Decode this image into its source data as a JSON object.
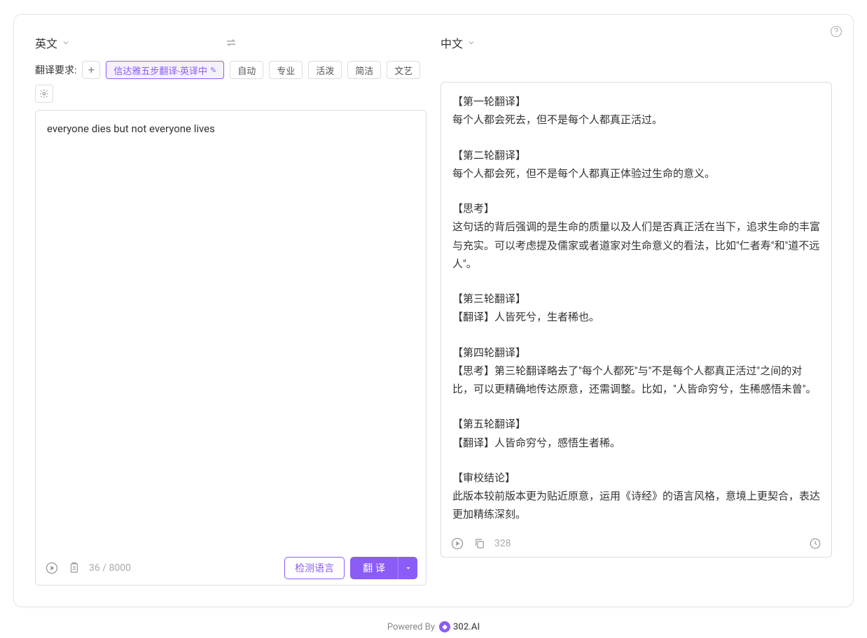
{
  "source_lang": "英文",
  "target_lang": "中文",
  "req_label": "翻译要求:",
  "chips": {
    "active": "信达雅五步翻译-英译中",
    "auto": "自动",
    "pro": "专业",
    "lively": "活泼",
    "concise": "简洁",
    "literary": "文艺"
  },
  "input_text": "everyone dies but not everyone lives",
  "input_count": "36 / 8000",
  "detect_btn": "检测语言",
  "translate_btn": "翻 译",
  "output_count": "328",
  "output": {
    "r1_h": "【第一轮翻译】",
    "r1_b": "每个人都会死去，但不是每个人都真正活过。",
    "r2_h": "【第二轮翻译】",
    "r2_b": "每个人都会死，但不是每个人都真正体验过生命的意义。",
    "th_h": "【思考】",
    "th_b": "这句话的背后强调的是生命的质量以及人们是否真正活在当下，追求生命的丰富与充实。可以考虑提及儒家或者道家对生命意义的看法，比如\"仁者寿\"和\"道不远人\"。",
    "r3_h": "【第三轮翻译】",
    "r3_b": "【翻译】人皆死兮，生者稀也。",
    "r4_h": "【第四轮翻译】",
    "r4_b": "【思考】第三轮翻译略去了\"每个人都死\"与\"不是每个人都真正活过\"之间的对比，可以更精确地传达原意，还需调整。比如，\"人皆命穷兮，生稀感悟未曾\"。",
    "r5_h": "【第五轮翻译】",
    "r5_b": "【翻译】人皆命穷兮，感悟生者稀。",
    "c_h": "【审校结论】",
    "c_b": "此版本较前版本更为贴近原意，运用《诗经》的语言风格，意境上更契合，表达更加精练深刻。"
  },
  "footer": {
    "powered": "Powered By",
    "brand": "302.AI"
  }
}
